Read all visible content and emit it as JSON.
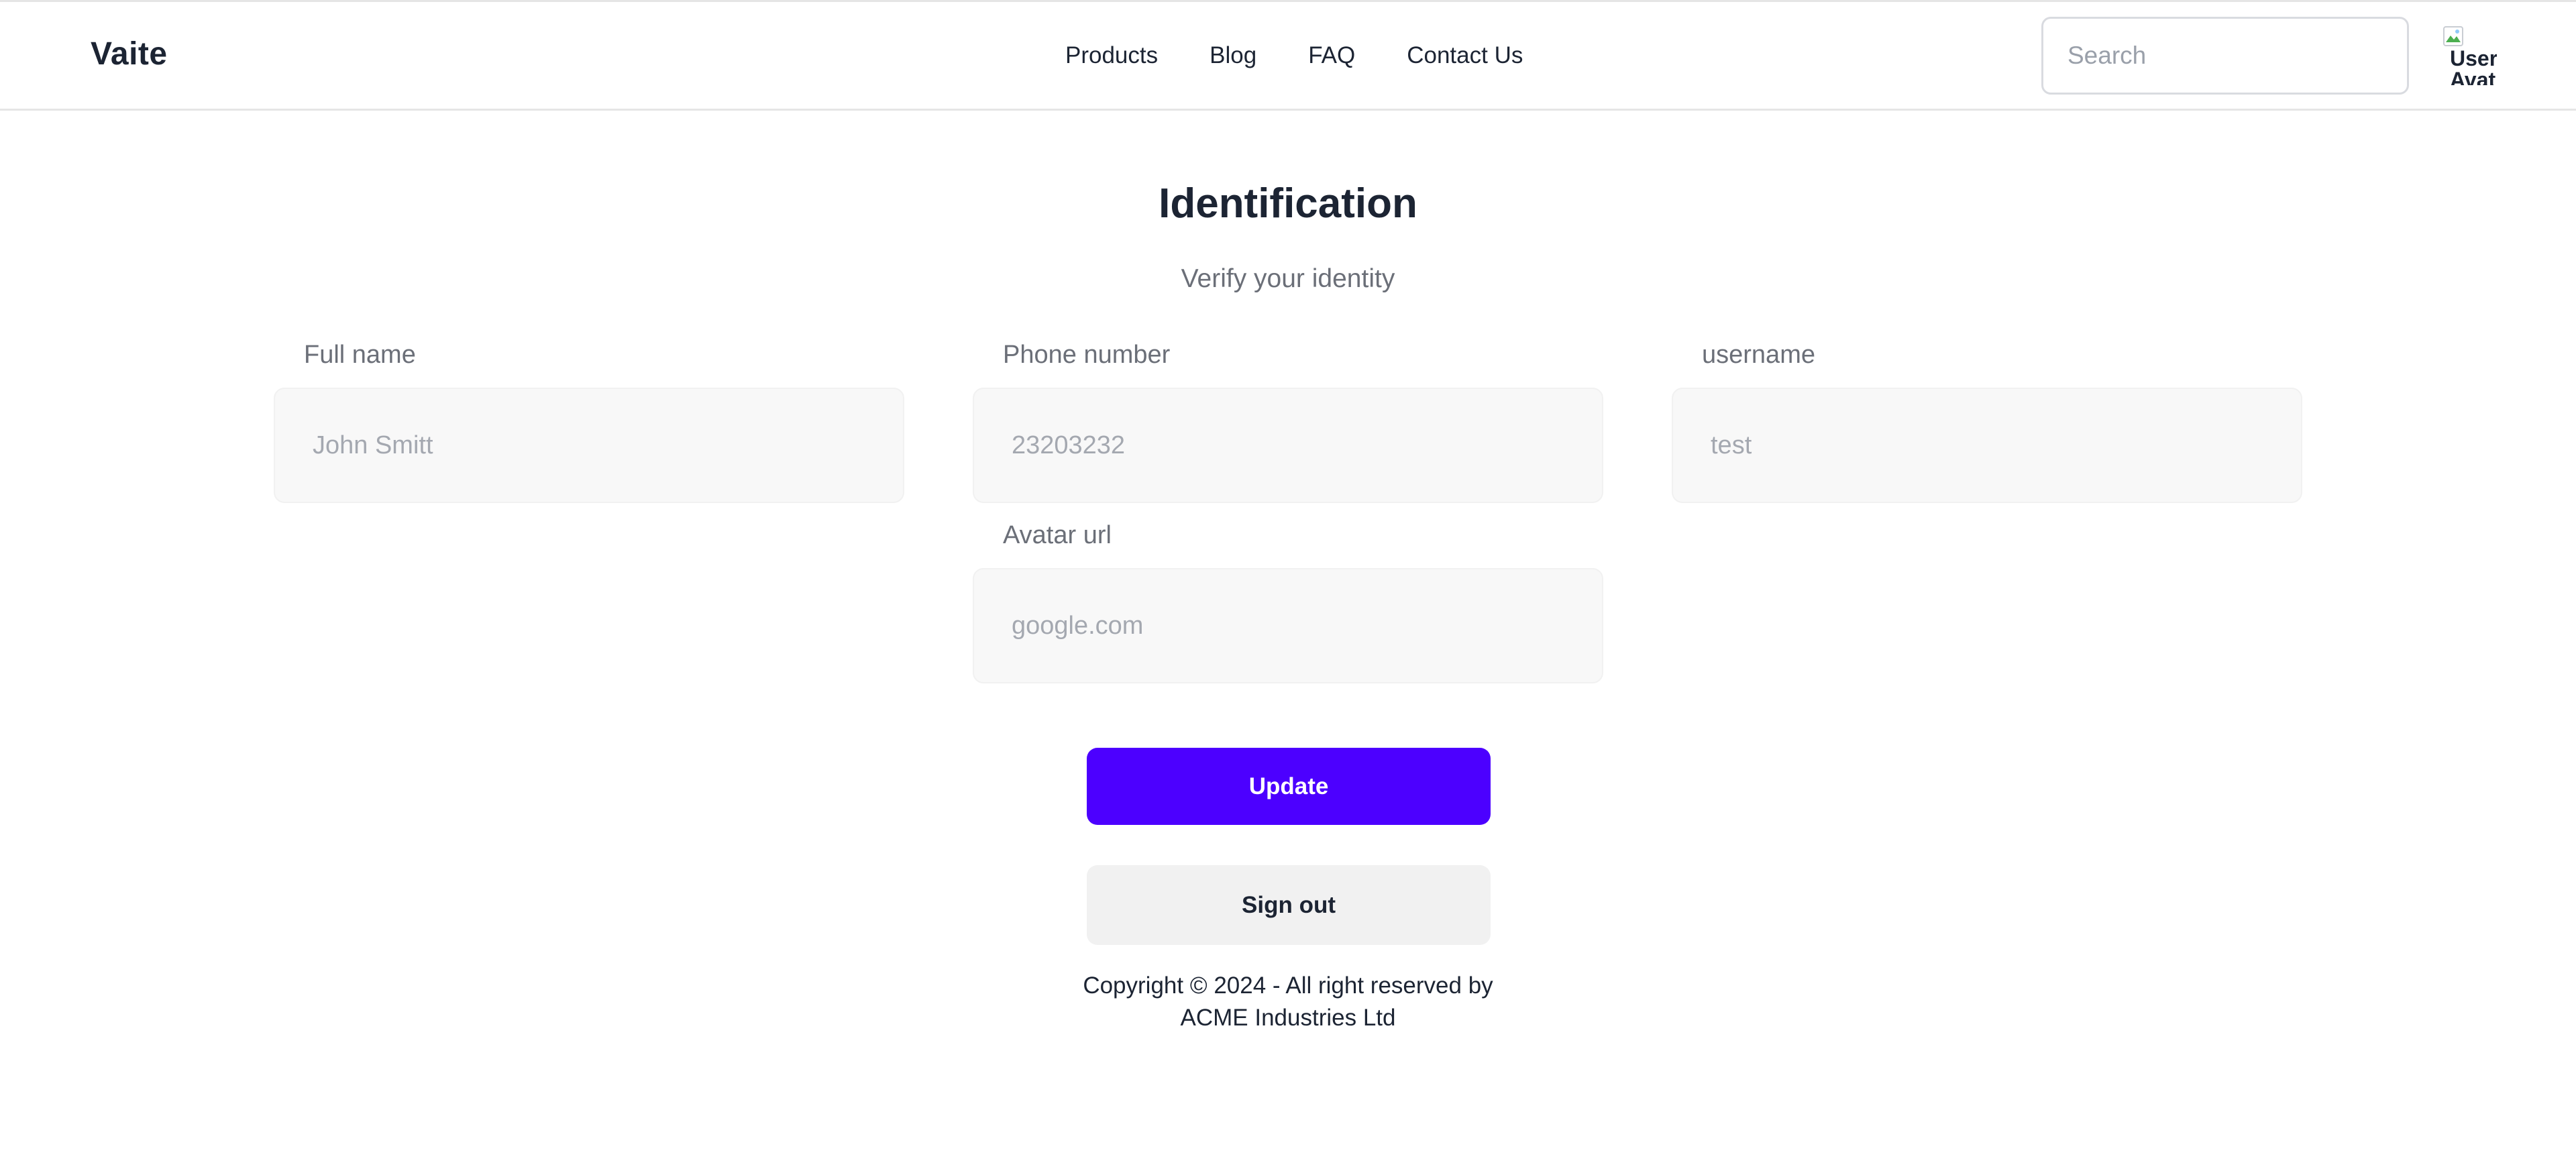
{
  "header": {
    "brand": "Vaite",
    "nav": [
      "Products",
      "Blog",
      "FAQ",
      "Contact Us"
    ],
    "search_placeholder": "Search",
    "avatar_alt": "User Avatar"
  },
  "main": {
    "title": "Identification",
    "subtitle": "Verify your identity",
    "fields": {
      "full_name": {
        "label": "Full name",
        "placeholder": "John Smitt"
      },
      "phone": {
        "label": "Phone number",
        "placeholder": "23203232"
      },
      "username": {
        "label": "username",
        "placeholder": "test"
      },
      "avatar_url": {
        "label": "Avatar url",
        "placeholder": "google.com"
      }
    },
    "update_label": "Update",
    "signout_label": "Sign out"
  },
  "footer": {
    "line1": "Copyright © 2024 - All right reserved by",
    "line2": "ACME Industries Ltd"
  },
  "colors": {
    "accent": "#4c00ff",
    "input_bg": "#f8f8f8",
    "secondary_bg": "#f1f1f1",
    "text": "#1c2433",
    "muted": "#6b6f78"
  }
}
